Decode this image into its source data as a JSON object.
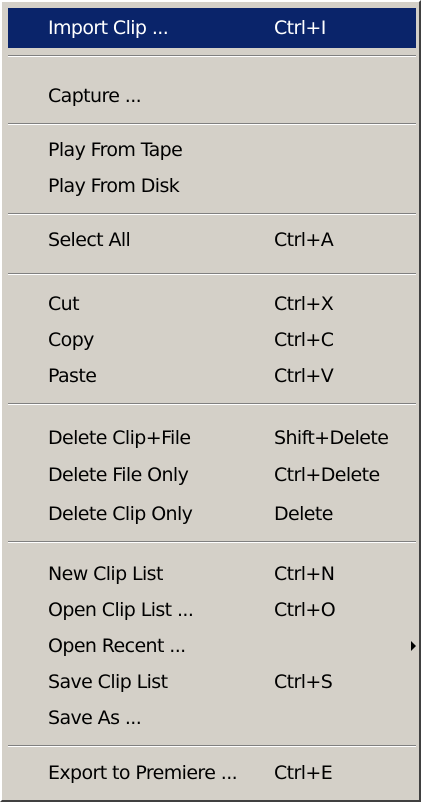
{
  "menu": {
    "import_clip": {
      "label": "Import Clip ...",
      "shortcut": "Ctrl+I"
    },
    "capture": {
      "label": "Capture ..."
    },
    "play_from_tape": {
      "label": "Play From Tape"
    },
    "play_from_disk": {
      "label": "Play From Disk"
    },
    "select_all": {
      "label": "Select All",
      "shortcut": "Ctrl+A"
    },
    "cut": {
      "label": "Cut",
      "shortcut": "Ctrl+X"
    },
    "copy": {
      "label": "Copy",
      "shortcut": "Ctrl+C"
    },
    "paste": {
      "label": "Paste",
      "shortcut": "Ctrl+V"
    },
    "delete_clip_file": {
      "label": "Delete Clip+File",
      "shortcut": "Shift+Delete"
    },
    "delete_file_only": {
      "label": "Delete File Only",
      "shortcut": "Ctrl+Delete"
    },
    "delete_clip_only": {
      "label": "Delete Clip Only",
      "shortcut": "Delete"
    },
    "new_clip_list": {
      "label": "New Clip List",
      "shortcut": "Ctrl+N"
    },
    "open_clip_list": {
      "label": "Open Clip List ...",
      "shortcut": "Ctrl+O"
    },
    "open_recent": {
      "label": "Open Recent ...",
      "submenu_icon": "chevron-right-icon"
    },
    "save_clip_list": {
      "label": "Save Clip List",
      "shortcut": "Ctrl+S"
    },
    "save_as": {
      "label": "Save As ..."
    },
    "export_to_premiere": {
      "label": "Export to Premiere ...",
      "shortcut": "Ctrl+E"
    }
  },
  "colors": {
    "menu_background": "#d4d0c8",
    "highlight": "#0a246a",
    "highlight_text": "#ffffff",
    "separator_dark": "#808080",
    "separator_light": "#ffffff"
  }
}
